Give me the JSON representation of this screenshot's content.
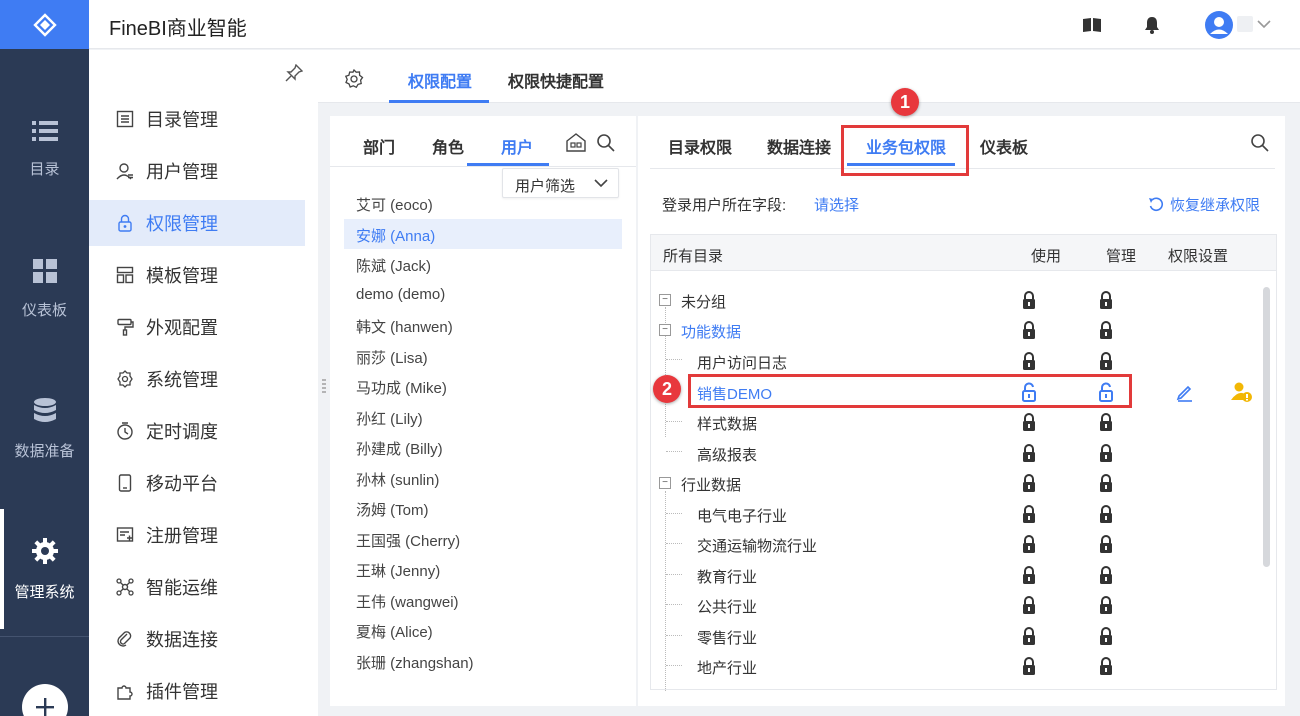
{
  "app": {
    "title": "FineBI商业智能"
  },
  "rail": {
    "items": [
      {
        "label": "目录",
        "icon": "list-icon"
      },
      {
        "label": "仪表板",
        "icon": "dashboard-icon"
      },
      {
        "label": "数据准备",
        "icon": "database-icon"
      },
      {
        "label": "管理系统",
        "icon": "gear-icon",
        "active": true
      }
    ]
  },
  "subnav": {
    "items": [
      {
        "label": "目录管理",
        "icon": "catalog-icon"
      },
      {
        "label": "用户管理",
        "icon": "user-icon"
      },
      {
        "label": "权限管理",
        "icon": "lock-icon",
        "active": true
      },
      {
        "label": "模板管理",
        "icon": "template-icon"
      },
      {
        "label": "外观配置",
        "icon": "brush-icon"
      },
      {
        "label": "系统管理",
        "icon": "settings-icon"
      },
      {
        "label": "定时调度",
        "icon": "timer-icon"
      },
      {
        "label": "移动平台",
        "icon": "mobile-icon"
      },
      {
        "label": "注册管理",
        "icon": "register-icon"
      },
      {
        "label": "智能运维",
        "icon": "ops-icon"
      },
      {
        "label": "数据连接",
        "icon": "link-icon"
      },
      {
        "label": "插件管理",
        "icon": "plugin-icon"
      }
    ]
  },
  "main_tabs": [
    {
      "label": "权限配置",
      "active": true
    },
    {
      "label": "权限快捷配置"
    }
  ],
  "user_panel": {
    "tabs": [
      {
        "label": "部门"
      },
      {
        "label": "角色"
      },
      {
        "label": "用户",
        "active": true
      }
    ],
    "filter_label": "用户筛选",
    "users": [
      "艾可 (eoco)",
      "安娜 (Anna)",
      "陈斌 (Jack)",
      "demo (demo)",
      "韩文 (hanwen)",
      "丽莎 (Lisa)",
      "马功成 (Mike)",
      "孙红 (Lily)",
      "孙建成 (Billy)",
      "孙林 (sunlin)",
      "汤姆 (Tom)",
      "王国强 (Cherry)",
      "王琳 (Jenny)",
      "王伟 (wangwei)",
      "夏梅 (Alice)",
      "张珊 (zhangshan)"
    ],
    "selected_index": 1
  },
  "perm_panel": {
    "tabs": [
      {
        "label": "目录权限"
      },
      {
        "label": "数据连接"
      },
      {
        "label": "业务包权限",
        "active": true
      },
      {
        "label": "仪表板"
      }
    ],
    "field_label": "登录用户所在字段:",
    "field_link": "请选择",
    "restore_label": "恢复继承权限",
    "columns": {
      "all": "所有目录",
      "use": "使用",
      "manage": "管理",
      "settings": "权限设置"
    },
    "rows": [
      {
        "label": "未分组",
        "level": 0,
        "expander": "−",
        "use": "locked",
        "manage": "locked"
      },
      {
        "label": "功能数据",
        "level": 0,
        "expander": "−",
        "blue": true,
        "use": "locked",
        "manage": "locked"
      },
      {
        "label": "用户访问日志",
        "level": 1,
        "use": "locked",
        "manage": "locked"
      },
      {
        "label": "销售DEMO",
        "level": 1,
        "blue": true,
        "use": "unlocked",
        "manage": "unlocked",
        "settings": true
      },
      {
        "label": "样式数据",
        "level": 1,
        "use": "locked",
        "manage": "locked"
      },
      {
        "label": "高级报表",
        "level": 1,
        "use": "locked",
        "manage": "locked"
      },
      {
        "label": "行业数据",
        "level": 0,
        "expander": "−",
        "use": "locked",
        "manage": "locked"
      },
      {
        "label": "电气电子行业",
        "level": 1,
        "use": "locked",
        "manage": "locked"
      },
      {
        "label": "交通运输物流行业",
        "level": 1,
        "use": "locked",
        "manage": "locked"
      },
      {
        "label": "教育行业",
        "level": 1,
        "use": "locked",
        "manage": "locked"
      },
      {
        "label": "公共行业",
        "level": 1,
        "use": "locked",
        "manage": "locked"
      },
      {
        "label": "零售行业",
        "level": 1,
        "use": "locked",
        "manage": "locked"
      },
      {
        "label": "地产行业",
        "level": 1,
        "use": "locked",
        "manage": "locked"
      }
    ]
  },
  "annotations": [
    "1",
    "2"
  ],
  "colors": {
    "accent": "#3f7cf3",
    "rail": "#2b3a55",
    "highlight": "#e23a3a",
    "warning": "#f2b705"
  }
}
